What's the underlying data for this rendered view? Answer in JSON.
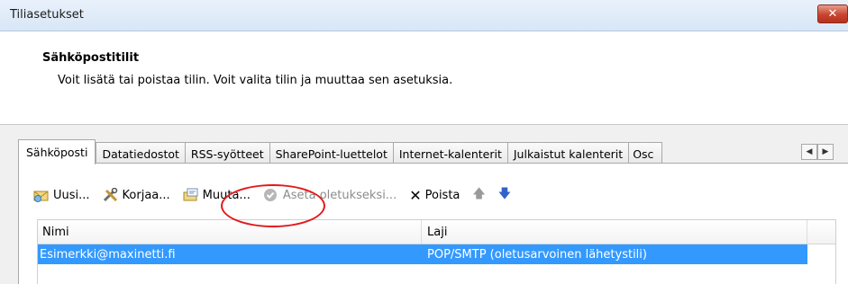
{
  "window": {
    "title": "Tiliasetukset"
  },
  "header": {
    "title": "Sähköpostitilit",
    "description": "Voit lisätä tai poistaa tilin. Voit valita tilin ja muuttaa sen asetuksia."
  },
  "tabs": [
    {
      "label": "Sähköposti",
      "active": true
    },
    {
      "label": "Datatiedostot"
    },
    {
      "label": "RSS-syötteet"
    },
    {
      "label": "SharePoint-luettelot"
    },
    {
      "label": "Internet-kalenterit"
    },
    {
      "label": "Julkaistut kalenterit"
    },
    {
      "label": "Osc"
    }
  ],
  "toolbar": {
    "new_label": "Uusi...",
    "repair_label": "Korjaa...",
    "change_label": "Muuta...",
    "set_default_label": "Aseta oletukseksi...",
    "remove_label": "Poista"
  },
  "table": {
    "columns": [
      "Nimi",
      "Laji"
    ],
    "rows": [
      {
        "name": "Esimerkki@maxinetti.fi",
        "type": "POP/SMTP (oletusarvoinen lähetystili)",
        "selected": true
      }
    ]
  },
  "colors": {
    "selection": "#3399ff",
    "annotation": "#e3191b"
  }
}
